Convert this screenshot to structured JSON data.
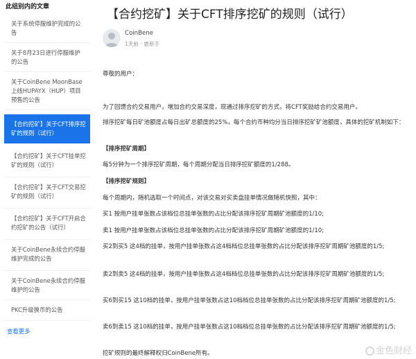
{
  "sidebar": {
    "title": "此组别内的文章",
    "items": [
      {
        "label": "关于系统停服维护完成的公告"
      },
      {
        "label": "关于8月23日进行停服维护的公告"
      },
      {
        "label": "关于CoinBene MoonBase上线HUPAYX（HUP）项目预售的公告"
      },
      {
        "label": "【合约挖矿】关于CFT排序挖矿的规则（试行）"
      },
      {
        "label": "【合约挖矿】关于CFT挂单挖矿的规则（试行）"
      },
      {
        "label": "【合约挖矿】关于CFT交易挖矿的规则（试行）"
      },
      {
        "label": "【合约挖矿】关于CFT开启合约挖矿的公告（试行）"
      },
      {
        "label": "关于CoinBene永续合约停服维护完成的公告"
      },
      {
        "label": "关于CoinBene永续合约停服维护的公告"
      },
      {
        "label": "PKC升级换币的公告"
      }
    ],
    "see_more": "查看更多"
  },
  "article": {
    "title": "【合约挖矿】关于CFT排序挖矿的规则（试行）",
    "author": "CoinBene",
    "meta": "1天前 · 更新于",
    "greeting": "尊敬的用户：",
    "paragraphs": [
      "为了回馈合约交易用户，增加合约交易深度，现通过排序挖矿的方式，将CFT奖励给合约交易用户。",
      "排序挖矿每日矿池额度占每日出矿总额度的25%，每个合约币种均分当日排序挖矿矿池额度，具体的挖矿机制如下：",
      "【排序挖矿周期】",
      "每5分钟为一个排序挖矿周期，每个周期分配当日排序挖矿额度的1/288。",
      "【排序挖矿规则】",
      "每个周期内，随机选取一个时间点，对该交易对买卖盘挂单情况做随机快照，其中：",
      "买1 按用户挂单张数占该档位总挂单张数的占比分配该排序挖矿周期矿池额度的1/10;",
      "卖1 按用户挂单张数占该档位总挂单张数的占比分配该排序挖矿周期矿池额度的1/10;",
      "买2到买5 这4档的挂单，按用户挂单张数占这4档档位总挂单张数的占比分配该排序挖矿周期矿池额度的1/5;",
      "卖2到卖5 这4档的挂单，按用户挂单张数占这4档档位总挂单张数的占比分配该排序挖矿周期矿池额度的1/5;",
      "买6到买15 这10档的挂单，按用户挂单张数占这10档档位总挂单张数的占比分配该排序挖矿周期矿池额度的1/5;",
      "卖6到卖15 这10档的挂单，按用户挂单张数占这10档档位总挂单张数的占比分配该排序挖矿周期矿池额度的1/5;",
      "挖矿规则的最终解释权归CoinBene所有。"
    ]
  },
  "watermark": "金色财经",
  "colors": {
    "accent": "#1a73e8",
    "text": "#333333",
    "muted": "#999999"
  },
  "icons": {
    "avatar": "user-avatar-icon",
    "watermark": "watermark-logo-icon"
  }
}
